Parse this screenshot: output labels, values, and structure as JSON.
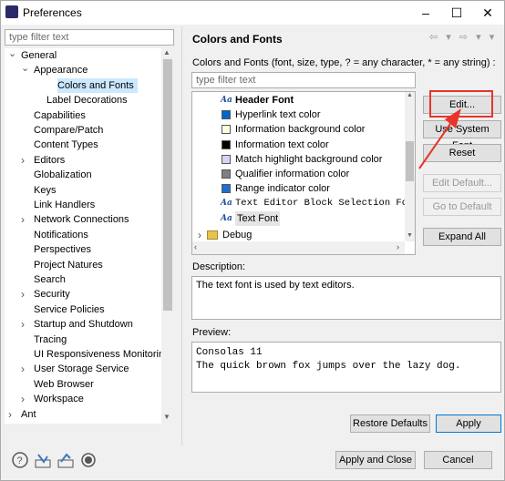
{
  "window": {
    "title": "Preferences",
    "minimize": "–",
    "maximize": "☐",
    "close": "✕"
  },
  "left": {
    "filter_placeholder": "type filter text",
    "tree": [
      {
        "label": "General",
        "level": 0,
        "twisty": "expanded"
      },
      {
        "label": "Appearance",
        "level": 1,
        "twisty": "expanded"
      },
      {
        "label": "Colors and Fonts",
        "level": 2,
        "twisty": "none",
        "selected": true
      },
      {
        "label": "Label Decorations",
        "level": 2,
        "twisty": "none"
      },
      {
        "label": "Capabilities",
        "level": 1,
        "twisty": "none"
      },
      {
        "label": "Compare/Patch",
        "level": 1,
        "twisty": "none"
      },
      {
        "label": "Content Types",
        "level": 1,
        "twisty": "none"
      },
      {
        "label": "Editors",
        "level": 1,
        "twisty": "collapsed"
      },
      {
        "label": "Globalization",
        "level": 1,
        "twisty": "none"
      },
      {
        "label": "Keys",
        "level": 1,
        "twisty": "none"
      },
      {
        "label": "Link Handlers",
        "level": 1,
        "twisty": "none"
      },
      {
        "label": "Network Connections",
        "level": 1,
        "twisty": "collapsed"
      },
      {
        "label": "Notifications",
        "level": 1,
        "twisty": "none"
      },
      {
        "label": "Perspectives",
        "level": 1,
        "twisty": "none"
      },
      {
        "label": "Project Natures",
        "level": 1,
        "twisty": "none"
      },
      {
        "label": "Search",
        "level": 1,
        "twisty": "none"
      },
      {
        "label": "Security",
        "level": 1,
        "twisty": "collapsed"
      },
      {
        "label": "Service Policies",
        "level": 1,
        "twisty": "none"
      },
      {
        "label": "Startup and Shutdown",
        "level": 1,
        "twisty": "collapsed"
      },
      {
        "label": "Tracing",
        "level": 1,
        "twisty": "none"
      },
      {
        "label": "UI Responsiveness Monitorin",
        "level": 1,
        "twisty": "none"
      },
      {
        "label": "User Storage Service",
        "level": 1,
        "twisty": "collapsed"
      },
      {
        "label": "Web Browser",
        "level": 1,
        "twisty": "none"
      },
      {
        "label": "Workspace",
        "level": 1,
        "twisty": "collapsed"
      },
      {
        "label": "Ant",
        "level": 0,
        "twisty": "collapsed"
      }
    ]
  },
  "right": {
    "title": "Colors and Fonts",
    "nav_icons": "⇦ ▾ ⇨ ▾ ▾",
    "description": "Colors and Fonts (font, size, type, ? = any character, * = any string) :",
    "filter_placeholder": "type filter text",
    "items": [
      {
        "label": "Header Font",
        "kind": "font",
        "bold": true
      },
      {
        "label": "Hyperlink text color",
        "kind": "color",
        "color": "#0066cc"
      },
      {
        "label": "Information background color",
        "kind": "color",
        "color": "#ffffe1"
      },
      {
        "label": "Information text color",
        "kind": "color",
        "color": "#000000"
      },
      {
        "label": "Match highlight background color",
        "kind": "color",
        "color": "#d4d4f8"
      },
      {
        "label": "Qualifier information color",
        "kind": "color",
        "color": "#808080"
      },
      {
        "label": "Range indicator color",
        "kind": "color",
        "color": "#1e6fd0"
      },
      {
        "label": "Text Editor Block Selection Font",
        "kind": "font",
        "mono": true
      },
      {
        "label": "Text Font",
        "kind": "font",
        "selected": true
      }
    ],
    "debug": "Debug",
    "buttons": {
      "edit": "Edit...",
      "use_system_font": "Use System Font",
      "reset": "Reset",
      "edit_default": "Edit Default...",
      "go_to_default": "Go to Default",
      "expand_all": "Expand All"
    },
    "description_label": "Description:",
    "description_text": "The text font is used by text editors.",
    "preview_label": "Preview:",
    "preview_lines": [
      "Consolas 11",
      "The quick brown fox jumps over the lazy dog."
    ],
    "restore_defaults": "Restore Defaults",
    "apply": "Apply"
  },
  "footer": {
    "apply_and_close": "Apply and Close",
    "cancel": "Cancel"
  },
  "colors": {
    "selection": "#cce8ff",
    "annotation": "#e8342a"
  }
}
